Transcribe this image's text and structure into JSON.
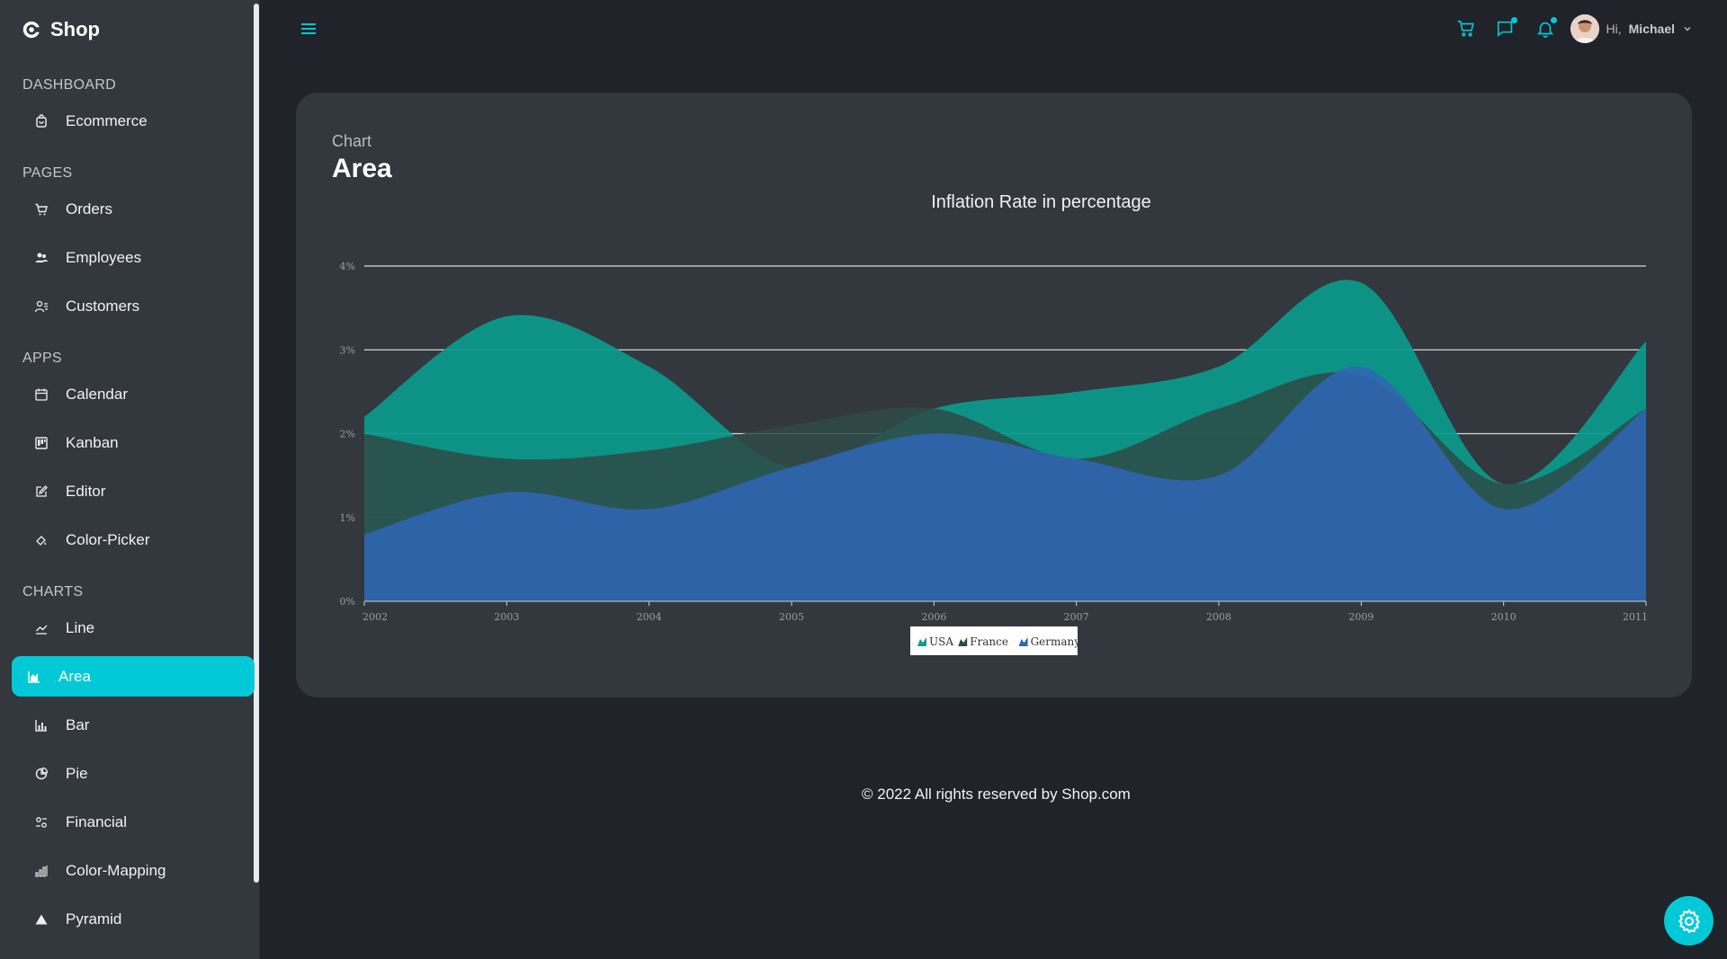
{
  "brand": {
    "name": "Shop"
  },
  "sidebar": {
    "sections": [
      {
        "title": "DASHBOARD",
        "items": [
          {
            "label": "Ecommerce",
            "icon": "bag-icon"
          }
        ]
      },
      {
        "title": "PAGES",
        "items": [
          {
            "label": "Orders",
            "icon": "cart-icon"
          },
          {
            "label": "Employees",
            "icon": "employees-icon"
          },
          {
            "label": "Customers",
            "icon": "customers-icon"
          }
        ]
      },
      {
        "title": "APPS",
        "items": [
          {
            "label": "Calendar",
            "icon": "calendar-icon"
          },
          {
            "label": "Kanban",
            "icon": "kanban-icon"
          },
          {
            "label": "Editor",
            "icon": "edit-icon"
          },
          {
            "label": "Color-Picker",
            "icon": "color-picker-icon"
          }
        ]
      },
      {
        "title": "CHARTS",
        "items": [
          {
            "label": "Line",
            "icon": "line-chart-icon"
          },
          {
            "label": "Area",
            "icon": "area-chart-icon",
            "active": true
          },
          {
            "label": "Bar",
            "icon": "bar-chart-icon"
          },
          {
            "label": "Pie",
            "icon": "pie-chart-icon"
          },
          {
            "label": "Financial",
            "icon": "financial-icon"
          },
          {
            "label": "Color-Mapping",
            "icon": "color-mapping-icon"
          },
          {
            "label": "Pyramid",
            "icon": "pyramid-icon"
          }
        ]
      }
    ]
  },
  "topbar": {
    "greeting": "Hi,",
    "user_name": "Michael",
    "icons": [
      "menu-icon",
      "cart-icon",
      "chat-icon",
      "bell-icon",
      "avatar"
    ]
  },
  "card": {
    "subtitle": "Chart",
    "title": "Area"
  },
  "footer": {
    "text": "© 2022 All rights reserved by Shop.com"
  },
  "colors": {
    "accent": "#03c9d7",
    "sidebar_bg": "#33373e",
    "page_bg": "#20232a",
    "card_bg": "#33373e"
  },
  "chart_data": {
    "type": "area",
    "title": "Inflation Rate in percentage",
    "xlabel": "",
    "ylabel": "",
    "x": [
      "2002",
      "2003",
      "2004",
      "2005",
      "2006",
      "2007",
      "2008",
      "2009",
      "2010",
      "2011"
    ],
    "ylim": [
      0,
      4
    ],
    "yticks": [
      "0%",
      "1%",
      "2%",
      "3%",
      "4%"
    ],
    "grid": true,
    "legend": "bottom-center",
    "series": [
      {
        "name": "USA",
        "color": "#0a9b8c",
        "values": [
          2.2,
          3.4,
          2.8,
          1.6,
          2.3,
          2.5,
          2.8,
          3.8,
          1.4,
          3.1
        ]
      },
      {
        "name": "France",
        "color": "#2f4a48",
        "values": [
          2.0,
          1.7,
          1.8,
          2.1,
          2.3,
          1.7,
          2.3,
          2.7,
          1.4,
          2.3
        ]
      },
      {
        "name": "Germany",
        "color": "#2f66b6",
        "values": [
          0.8,
          1.3,
          1.1,
          1.6,
          2.0,
          1.7,
          1.5,
          2.8,
          1.1,
          2.3
        ]
      }
    ]
  }
}
